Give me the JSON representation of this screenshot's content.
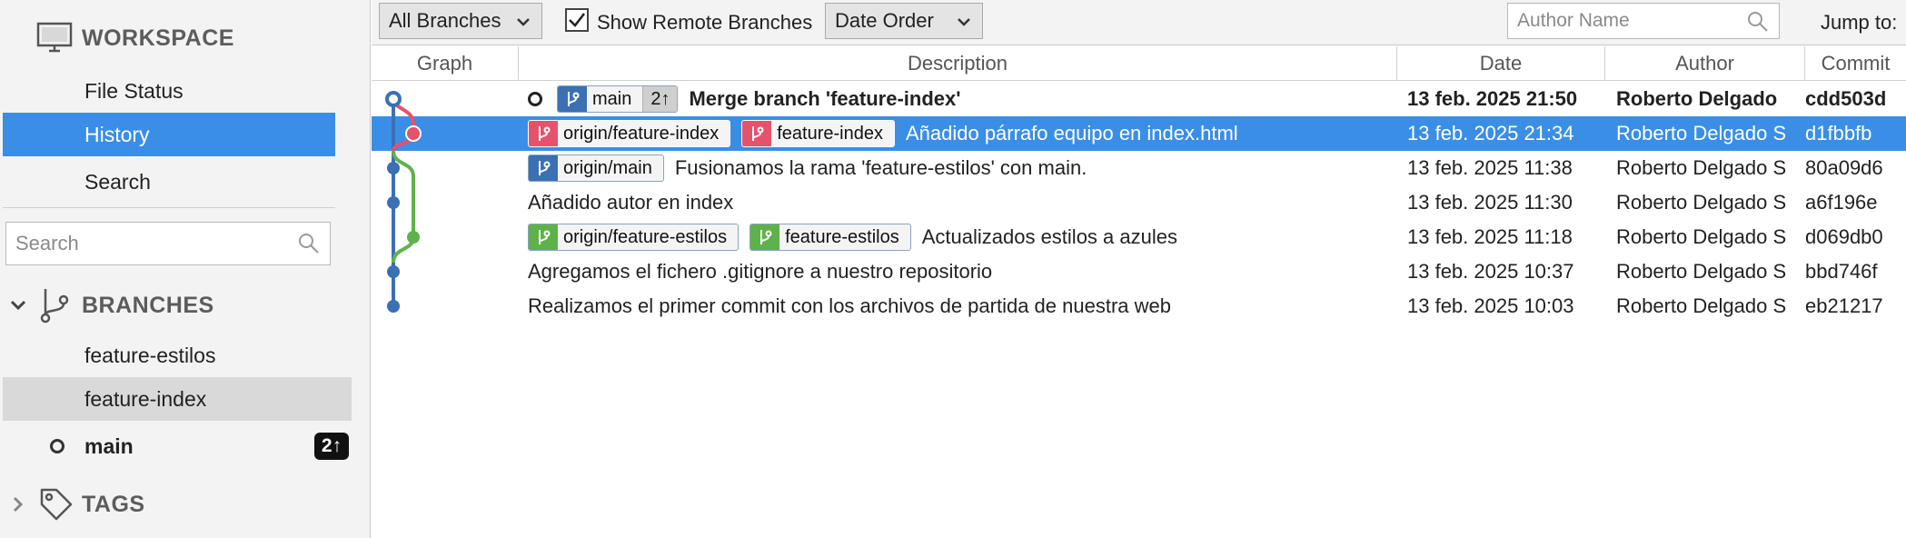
{
  "colors": {
    "accent_blue": "#3a8ee6",
    "branch_main": "#3b70b3",
    "branch_index": "#e5526b",
    "branch_estilos": "#5eb24a"
  },
  "sidebar": {
    "workspace": {
      "label": "WORKSPACE",
      "icon": "monitor-icon",
      "items": [
        {
          "label": "File Status"
        },
        {
          "label": "History"
        },
        {
          "label": "Search"
        }
      ]
    },
    "search": {
      "placeholder": "Search"
    },
    "branches": {
      "label": "BRANCHES",
      "icon": "branch-icon",
      "items": [
        {
          "label": "feature-estilos"
        },
        {
          "label": "feature-index"
        },
        {
          "label": "main",
          "badge": "2↑"
        }
      ]
    },
    "tags": {
      "label": "TAGS",
      "icon": "tag-icon"
    }
  },
  "toolbar": {
    "branch_filter": "All Branches",
    "show_remote_label": "Show Remote Branches",
    "show_remote_checked": true,
    "order": "Date Order",
    "author_placeholder": "Author Name",
    "jump_to": "Jump to:"
  },
  "columns": {
    "graph": "Graph",
    "description": "Description",
    "date": "Date",
    "author": "Author",
    "commit": "Commit"
  },
  "commits": [
    {
      "labels": [
        {
          "name": "main",
          "count": "2↑"
        }
      ],
      "message": "Merge branch 'feature-index'",
      "date": "13 feb. 2025 21:50",
      "author": "Roberto Delgado",
      "hash": "cdd503d"
    },
    {
      "labels": [
        {
          "name": "origin/feature-index"
        },
        {
          "name": "feature-index"
        }
      ],
      "message": "Añadido párrafo equipo en index.html",
      "date": "13 feb. 2025 21:34",
      "author": "Roberto Delgado S",
      "hash": "d1fbbfb"
    },
    {
      "labels": [
        {
          "name": "origin/main"
        }
      ],
      "message": "Fusionamos la rama 'feature-estilos' con main.",
      "date": "13 feb. 2025 11:38",
      "author": "Roberto Delgado S",
      "hash": "80a09d6"
    },
    {
      "labels": [],
      "message": "Añadido autor en index",
      "date": "13 feb. 2025 11:30",
      "author": "Roberto Delgado S",
      "hash": "a6f196e"
    },
    {
      "labels": [
        {
          "name": "origin/feature-estilos"
        },
        {
          "name": "feature-estilos"
        }
      ],
      "message": "Actualizados estilos a azules",
      "date": "13 feb. 2025 11:18",
      "author": "Roberto Delgado S",
      "hash": "d069db0"
    },
    {
      "labels": [],
      "message": "Agregamos el fichero .gitignore a nuestro repositorio",
      "date": "13 feb. 2025 10:37",
      "author": "Roberto Delgado S",
      "hash": "bbd746f"
    },
    {
      "labels": [],
      "message": "Realizamos el primer commit con los archivos de partida de nuestra web",
      "date": "13 feb. 2025 10:03",
      "author": "Roberto Delgado S",
      "hash": "eb21217"
    }
  ]
}
